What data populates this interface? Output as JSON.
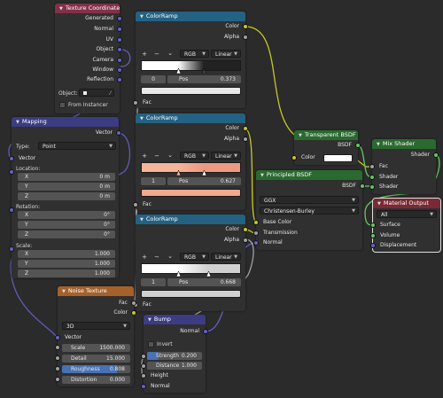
{
  "colors": {
    "vector": "#6363c7",
    "color": "#c7c729",
    "float": "#a1a1a1",
    "shader": "#63c763"
  },
  "texture_coordinate": {
    "title": "Texture Coordinate",
    "outputs": [
      "Generated",
      "Normal",
      "UV",
      "Object",
      "Camera",
      "Window",
      "Reflection"
    ],
    "object_label": "Object:",
    "from_instancer": "From Instancer"
  },
  "mapping": {
    "title": "Mapping",
    "output": "Vector",
    "type_label": "Type:",
    "type_value": "Point",
    "vector_input": "Vector",
    "location_label": "Location:",
    "location": [
      {
        "axis": "X",
        "value": "0 m"
      },
      {
        "axis": "Y",
        "value": "0 m"
      },
      {
        "axis": "Z",
        "value": "0 m"
      }
    ],
    "rotation_label": "Rotation:",
    "rotation": [
      {
        "axis": "X",
        "value": "0°"
      },
      {
        "axis": "Y",
        "value": "0°"
      },
      {
        "axis": "Z",
        "value": "0°"
      }
    ],
    "scale_label": "Scale:",
    "scale": [
      {
        "axis": "X",
        "value": "1.000"
      },
      {
        "axis": "Y",
        "value": "1.000"
      },
      {
        "axis": "Z",
        "value": "1.000"
      }
    ]
  },
  "ramp1": {
    "title": "ColorRamp",
    "out_color": "Color",
    "out_alpha": "Alpha",
    "plus": "+",
    "minus": "−",
    "chevron": "⌄",
    "mode": "RGB",
    "interp": "Linear",
    "index": "0",
    "pos_label": "Pos",
    "pos": "0.373",
    "fac": "Fac"
  },
  "ramp2": {
    "title": "ColorRamp",
    "out_color": "Color",
    "out_alpha": "Alpha",
    "plus": "+",
    "minus": "−",
    "chevron": "⌄",
    "mode": "RGB",
    "interp": "Linear",
    "index": "1",
    "pos_label": "Pos",
    "pos": "0.627",
    "fac": "Fac"
  },
  "ramp3": {
    "title": "ColorRamp",
    "out_color": "Color",
    "out_alpha": "Alpha",
    "plus": "+",
    "minus": "−",
    "chevron": "⌄",
    "mode": "RGB",
    "interp": "Linear",
    "index": "1",
    "pos_label": "Pos",
    "pos": "0.668",
    "fac": "Fac"
  },
  "noise": {
    "title": "Noise Texture",
    "out_fac": "Fac",
    "out_color": "Color",
    "dimensions": "3D",
    "vector": "Vector",
    "params": [
      {
        "label": "Scale",
        "value": "1500.000"
      },
      {
        "label": "Detail",
        "value": "15.000"
      },
      {
        "label": "Roughness",
        "value": "0.808"
      },
      {
        "label": "Distortion",
        "value": "0.000"
      }
    ]
  },
  "bump": {
    "title": "Bump",
    "out_normal": "Normal",
    "invert": "Invert",
    "params": [
      {
        "label": "Strength",
        "value": "0.200"
      },
      {
        "label": "Distance",
        "value": "1.000"
      }
    ],
    "height": "Height",
    "normal": "Normal"
  },
  "transparent": {
    "title": "Transparent BSDF",
    "out": "BSDF",
    "color_label": "Color"
  },
  "principled": {
    "title": "Principled BSDF",
    "out": "BSDF",
    "distribution": "GGX",
    "subsurface": "Christensen-Burley",
    "inputs": [
      "Base Color",
      "Transmission",
      "Normal"
    ]
  },
  "mix": {
    "title": "Mix Shader",
    "out": "Shader",
    "inputs": [
      "Fac",
      "Shader",
      "Shader"
    ]
  },
  "output": {
    "title": "Material Output",
    "target": "All",
    "inputs": [
      "Surface",
      "Volume",
      "Displacement"
    ]
  }
}
